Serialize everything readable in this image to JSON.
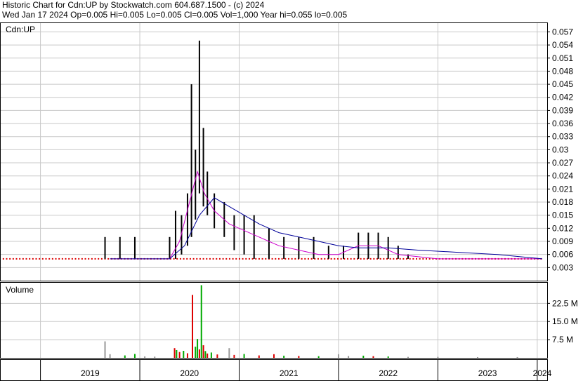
{
  "header": {
    "line1": "Historic Chart for Cdn:UP by Stockwatch.com 604.687.1500 - (c) 2024",
    "line2": "Wed Jan 17 2024   Op=0.005   Hi=0.005   Lo=0.005   Cl=0.005   Vol=1,000   Year hi=0.055   lo=0.005"
  },
  "colors": {
    "price": "#000000",
    "ma_short": "#cc00cc",
    "ma_long": "#000099",
    "up_volume": "#00aa00",
    "down_volume": "#dd0000",
    "flat_volume": "#999999",
    "grid": "#c8c8c8",
    "dots": "#dd0000"
  },
  "chart_data": [
    {
      "type": "line",
      "title": "Cdn:UP",
      "ylim": [
        0,
        0.059
      ],
      "yticks": [
        "0.057",
        "0.054",
        "0.051",
        "0.048",
        "0.045",
        "0.042",
        "0.039",
        "0.036",
        "0.033",
        "0.03",
        "0.027",
        "0.024",
        "0.021",
        "0.018",
        "0.015",
        "0.012",
        "0.009",
        "0.006",
        "0.003"
      ],
      "xlim": [
        2018.6,
        2024.1
      ],
      "x_labels": [
        "2019",
        "2020",
        "2021",
        "2022",
        "2023",
        "2024"
      ],
      "price_ohlc": [
        {
          "x": 2019.65,
          "hi": 0.01,
          "lo": 0.005
        },
        {
          "x": 2019.8,
          "hi": 0.01,
          "lo": 0.005
        },
        {
          "x": 2019.95,
          "hi": 0.01,
          "lo": 0.005
        },
        {
          "x": 2020.3,
          "hi": 0.01,
          "lo": 0.005
        },
        {
          "x": 2020.36,
          "hi": 0.016,
          "lo": 0.005
        },
        {
          "x": 2020.42,
          "hi": 0.015,
          "lo": 0.006
        },
        {
          "x": 2020.48,
          "hi": 0.02,
          "lo": 0.008
        },
        {
          "x": 2020.52,
          "hi": 0.045,
          "lo": 0.01
        },
        {
          "x": 2020.56,
          "hi": 0.03,
          "lo": 0.014
        },
        {
          "x": 2020.6,
          "hi": 0.055,
          "lo": 0.02
        },
        {
          "x": 2020.64,
          "hi": 0.035,
          "lo": 0.017
        },
        {
          "x": 2020.68,
          "hi": 0.025,
          "lo": 0.015
        },
        {
          "x": 2020.75,
          "hi": 0.02,
          "lo": 0.012
        },
        {
          "x": 2020.85,
          "hi": 0.018,
          "lo": 0.01
        },
        {
          "x": 2020.95,
          "hi": 0.015,
          "lo": 0.007
        },
        {
          "x": 2021.05,
          "hi": 0.015,
          "lo": 0.006
        },
        {
          "x": 2021.15,
          "hi": 0.015,
          "lo": 0.005
        },
        {
          "x": 2021.3,
          "hi": 0.012,
          "lo": 0.005
        },
        {
          "x": 2021.45,
          "hi": 0.01,
          "lo": 0.005
        },
        {
          "x": 2021.6,
          "hi": 0.01,
          "lo": 0.005
        },
        {
          "x": 2021.75,
          "hi": 0.01,
          "lo": 0.005
        },
        {
          "x": 2021.9,
          "hi": 0.008,
          "lo": 0.005
        },
        {
          "x": 2022.05,
          "hi": 0.008,
          "lo": 0.005
        },
        {
          "x": 2022.2,
          "hi": 0.011,
          "lo": 0.005
        },
        {
          "x": 2022.3,
          "hi": 0.011,
          "lo": 0.005
        },
        {
          "x": 2022.4,
          "hi": 0.011,
          "lo": 0.005
        },
        {
          "x": 2022.5,
          "hi": 0.01,
          "lo": 0.005
        },
        {
          "x": 2022.6,
          "hi": 0.008,
          "lo": 0.005
        },
        {
          "x": 2022.7,
          "hi": 0.006,
          "lo": 0.005
        }
      ],
      "series": [
        {
          "values": [
            [
              2019.7,
              0.005
            ],
            [
              2020.0,
              0.005
            ],
            [
              2020.3,
              0.005
            ],
            [
              2020.4,
              0.009
            ],
            [
              2020.5,
              0.018
            ],
            [
              2020.58,
              0.025
            ],
            [
              2020.65,
              0.02
            ],
            [
              2020.75,
              0.016
            ],
            [
              2020.9,
              0.013
            ],
            [
              2021.0,
              0.012
            ],
            [
              2021.2,
              0.01
            ],
            [
              2021.4,
              0.008
            ],
            [
              2021.6,
              0.007
            ],
            [
              2021.8,
              0.006
            ],
            [
              2022.0,
              0.006
            ],
            [
              2022.2,
              0.008
            ],
            [
              2022.4,
              0.008
            ],
            [
              2022.6,
              0.006
            ],
            [
              2023.0,
              0.005
            ],
            [
              2023.5,
              0.005
            ],
            [
              2024.05,
              0.005
            ]
          ]
        },
        {
          "values": [
            [
              2019.7,
              0.005
            ],
            [
              2020.0,
              0.005
            ],
            [
              2020.3,
              0.005
            ],
            [
              2020.45,
              0.008
            ],
            [
              2020.6,
              0.015
            ],
            [
              2020.75,
              0.019
            ],
            [
              2020.9,
              0.017
            ],
            [
              2021.05,
              0.015
            ],
            [
              2021.2,
              0.013
            ],
            [
              2021.4,
              0.011
            ],
            [
              2021.6,
              0.01
            ],
            [
              2021.8,
              0.009
            ],
            [
              2022.0,
              0.008
            ],
            [
              2022.2,
              0.0075
            ],
            [
              2022.5,
              0.0075
            ],
            [
              2022.8,
              0.007
            ],
            [
              2023.2,
              0.0065
            ],
            [
              2023.6,
              0.006
            ],
            [
              2024.05,
              0.005
            ]
          ]
        }
      ]
    },
    {
      "type": "bar",
      "title": "Volume",
      "ylim": [
        0,
        31
      ],
      "yticks": [
        "22.5 M",
        "15.0 M",
        "7.5 M"
      ],
      "bars": [
        {
          "x": 2019.65,
          "v": 6.8,
          "c": "flat"
        },
        {
          "x": 2019.7,
          "v": 1.5,
          "c": "flat"
        },
        {
          "x": 2019.85,
          "v": 1.0,
          "c": "up"
        },
        {
          "x": 2019.95,
          "v": 1.6,
          "c": "up"
        },
        {
          "x": 2020.05,
          "v": 0.6,
          "c": "flat"
        },
        {
          "x": 2020.15,
          "v": 0.5,
          "c": "flat"
        },
        {
          "x": 2020.35,
          "v": 4.0,
          "c": "down"
        },
        {
          "x": 2020.37,
          "v": 3.2,
          "c": "up"
        },
        {
          "x": 2020.4,
          "v": 2.4,
          "c": "down"
        },
        {
          "x": 2020.44,
          "v": 2.9,
          "c": "up"
        },
        {
          "x": 2020.48,
          "v": 1.9,
          "c": "down"
        },
        {
          "x": 2020.53,
          "v": 26.0,
          "c": "down"
        },
        {
          "x": 2020.56,
          "v": 4.6,
          "c": "up"
        },
        {
          "x": 2020.58,
          "v": 7.8,
          "c": "up"
        },
        {
          "x": 2020.6,
          "v": 3.5,
          "c": "down"
        },
        {
          "x": 2020.62,
          "v": 30.0,
          "c": "up"
        },
        {
          "x": 2020.64,
          "v": 5.2,
          "c": "down"
        },
        {
          "x": 2020.66,
          "v": 2.8,
          "c": "up"
        },
        {
          "x": 2020.68,
          "v": 1.8,
          "c": "down"
        },
        {
          "x": 2020.72,
          "v": 2.2,
          "c": "up"
        },
        {
          "x": 2020.78,
          "v": 1.4,
          "c": "down"
        },
        {
          "x": 2020.9,
          "v": 4.0,
          "c": "flat"
        },
        {
          "x": 2020.95,
          "v": 1.2,
          "c": "down"
        },
        {
          "x": 2021.05,
          "v": 1.6,
          "c": "up"
        },
        {
          "x": 2021.2,
          "v": 1.0,
          "c": "down"
        },
        {
          "x": 2021.35,
          "v": 1.5,
          "c": "down"
        },
        {
          "x": 2021.45,
          "v": 0.9,
          "c": "up"
        },
        {
          "x": 2021.6,
          "v": 0.8,
          "c": "down"
        },
        {
          "x": 2021.8,
          "v": 0.7,
          "c": "up"
        },
        {
          "x": 2022.0,
          "v": 1.5,
          "c": "flat"
        },
        {
          "x": 2022.1,
          "v": 0.8,
          "c": "flat"
        },
        {
          "x": 2022.25,
          "v": 0.9,
          "c": "up"
        },
        {
          "x": 2022.35,
          "v": 0.7,
          "c": "down"
        },
        {
          "x": 2022.5,
          "v": 0.6,
          "c": "up"
        },
        {
          "x": 2022.7,
          "v": 0.4,
          "c": "flat"
        },
        {
          "x": 2023.0,
          "v": 0.4,
          "c": "flat"
        },
        {
          "x": 2023.4,
          "v": 0.3,
          "c": "flat"
        },
        {
          "x": 2023.8,
          "v": 0.3,
          "c": "flat"
        }
      ]
    }
  ]
}
